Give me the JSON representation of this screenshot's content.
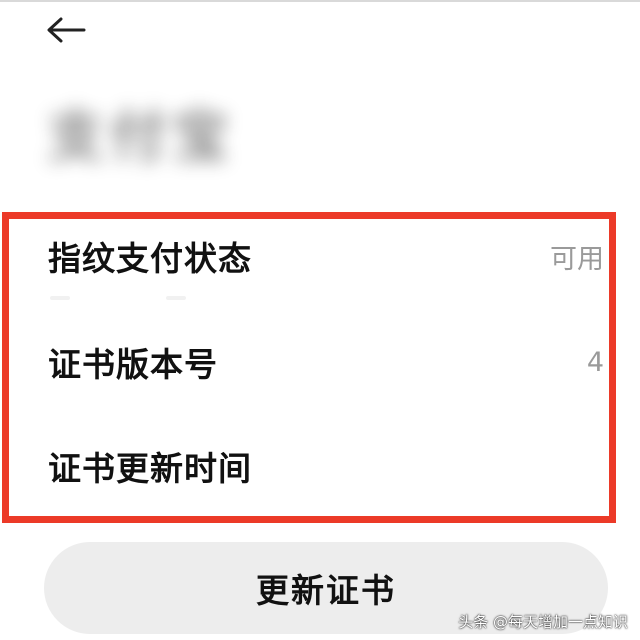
{
  "header": {
    "back_icon": "arrow-left-icon",
    "title": "支付宝"
  },
  "settings": {
    "rows": [
      {
        "label": "指纹支付状态",
        "value": "可用"
      },
      {
        "label": "证书版本号",
        "value": "4"
      },
      {
        "label": "证书更新时间",
        "value": ""
      }
    ]
  },
  "actions": {
    "update_button_label": "更新证书"
  },
  "watermark": {
    "text": "头条 @每天增加一点知识"
  },
  "colors": {
    "highlight_border": "#ec3a28",
    "button_background": "#ededed",
    "value_text": "#9a9a9a"
  }
}
